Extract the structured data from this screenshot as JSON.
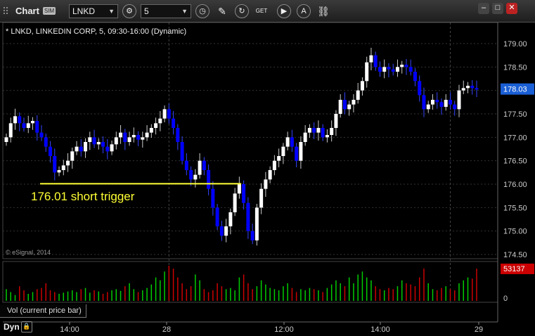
{
  "toolbar": {
    "title": "Chart",
    "badge": "SIM",
    "symbol": "LNKD",
    "interval": "5",
    "icons": [
      "settings-gear-icon",
      "history-clock-icon",
      "pencil-draw-icon",
      "refresh-icon",
      "get-quote-icon",
      "play-icon",
      "alert-icon",
      "link-icon"
    ],
    "get_label": "GET",
    "alert_label": "A"
  },
  "window": {
    "minimize": "–",
    "maximize": "□",
    "close": "✕"
  },
  "chart": {
    "caption": "* LNKD, LINKEDIN CORP, 5, 09:30-16:00 (Dynamic)",
    "copyright": "© eSignal, 2014",
    "annotation": "176.01 short trigger",
    "trigger_price": 176.01,
    "price_ticks": [
      "179.00",
      "178.50",
      "178.00",
      "177.50",
      "177.00",
      "176.50",
      "176.00",
      "175.50",
      "175.00",
      "174.50"
    ],
    "last_price": "178.03",
    "last_volume": "53137",
    "volume_zero": "0",
    "time_ticks": [
      "14:00",
      "28",
      "12:00",
      "14:00",
      "29"
    ],
    "volume_label": "Vol (current price bar)",
    "dyn_label": "Dyn",
    "colors": {
      "up": "#ffffff",
      "down": "#0000ff",
      "trigger": "#ffff33",
      "vol_up": "#00cc00",
      "vol_down": "#cc0000",
      "price_tag": "#1a5fd6",
      "vol_tag": "#cc0000"
    }
  },
  "chart_data": {
    "type": "candlestick",
    "ylim": [
      174.5,
      179.2
    ],
    "closes": [
      177.0,
      177.3,
      177.45,
      177.3,
      177.2,
      177.3,
      177.35,
      177.1,
      177.0,
      176.8,
      176.6,
      176.25,
      176.3,
      176.4,
      176.5,
      176.7,
      176.8,
      176.7,
      176.9,
      177.0,
      176.85,
      176.9,
      176.8,
      176.7,
      176.85,
      177.0,
      177.1,
      176.9,
      177.0,
      177.05,
      176.95,
      177.0,
      177.1,
      177.2,
      177.3,
      177.4,
      177.6,
      177.4,
      177.2,
      176.9,
      176.5,
      176.3,
      176.1,
      176.2,
      176.5,
      176.3,
      175.9,
      175.5,
      175.1,
      174.9,
      175.1,
      175.4,
      175.8,
      176.0,
      175.6,
      175.0,
      174.8,
      175.5,
      175.9,
      176.1,
      176.3,
      176.5,
      176.6,
      176.8,
      177.0,
      176.8,
      176.5,
      176.9,
      177.1,
      177.2,
      177.1,
      177.2,
      177.0,
      177.05,
      177.2,
      177.5,
      177.8,
      177.6,
      177.7,
      177.8,
      178.0,
      178.2,
      178.6,
      178.75,
      178.5,
      178.4,
      178.5,
      178.45,
      178.4,
      178.5,
      178.55,
      178.5,
      178.4,
      178.2,
      177.9,
      177.6,
      177.7,
      177.8,
      177.75,
      177.65,
      177.8,
      177.7,
      177.6,
      178.0,
      178.05,
      178.1,
      178.05,
      178.03
    ],
    "volumes": [
      20,
      15,
      10,
      25,
      18,
      12,
      15,
      20,
      22,
      30,
      18,
      15,
      12,
      14,
      16,
      18,
      15,
      20,
      22,
      14,
      18,
      16,
      12,
      15,
      18,
      20,
      17,
      25,
      30,
      20,
      15,
      18,
      22,
      28,
      40,
      35,
      50,
      60,
      55,
      40,
      30,
      20,
      25,
      45,
      35,
      20,
      15,
      18,
      30,
      25,
      20,
      22,
      18,
      40,
      45,
      30,
      20,
      25,
      35,
      28,
      22,
      20,
      18,
      25,
      30,
      22,
      15,
      20,
      18,
      22,
      20,
      18,
      15,
      22,
      28,
      35,
      30,
      25,
      40,
      30,
      45,
      50,
      40,
      35,
      25,
      20,
      18,
      22,
      20,
      25,
      35,
      30,
      28,
      25,
      40,
      55,
      30,
      20,
      18,
      22,
      25,
      20,
      18,
      30,
      35,
      40,
      38,
      55
    ]
  }
}
